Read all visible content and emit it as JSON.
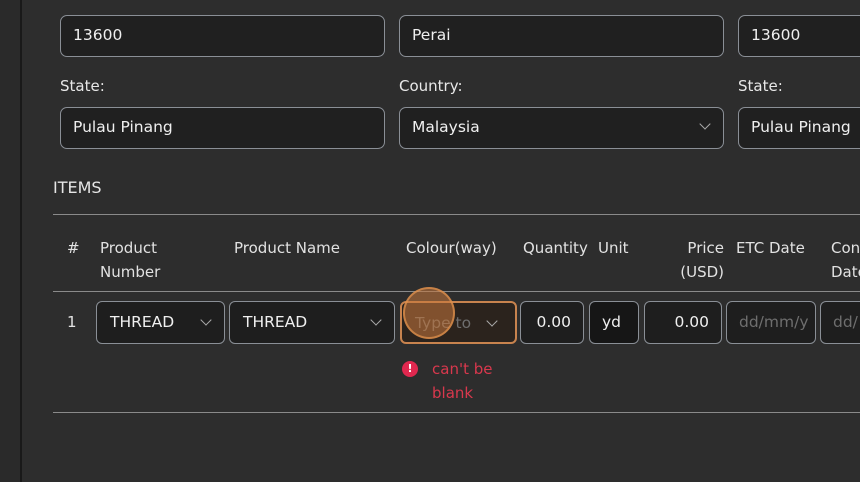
{
  "address_left": {
    "postcode": "13600",
    "state_label": "State:",
    "state": "Pulau Pinang"
  },
  "address_mid": {
    "city": "Perai",
    "country_label": "Country:",
    "country": "Malaysia"
  },
  "address_right": {
    "postcode": "13600",
    "state_label": "State:",
    "state": "Pulau Pinang"
  },
  "items": {
    "title": "ITEMS",
    "headers": {
      "num": "#",
      "product_number": "Product Number",
      "product_name": "Product Name",
      "colourway": "Colour(way)",
      "quantity": "Quantity",
      "unit": "Unit",
      "price": "Price (USD)",
      "etc_date": "ETC Date",
      "con_date": "Con Date"
    },
    "rows": [
      {
        "num": "1",
        "product_number": "THREAD",
        "product_name": "THREAD",
        "colourway_placeholder": "Type to",
        "quantity": "0.00",
        "unit": "yd",
        "price": "0.00",
        "etc_date_placeholder": "dd/mm/y",
        "con_date_placeholder": "dd/"
      }
    ],
    "error": {
      "icon": "!",
      "message": "can't be blank"
    }
  }
}
